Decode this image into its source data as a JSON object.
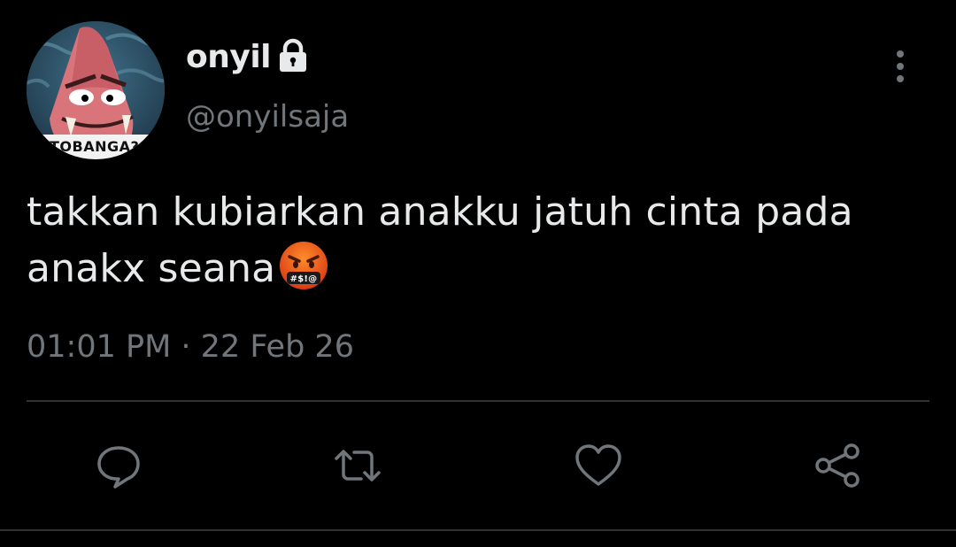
{
  "author": {
    "display_name": "onyil",
    "handle": "@onyilsaja",
    "verified_lock": "lock-icon",
    "avatar_caption": "TOBANGA?"
  },
  "tweet": {
    "text_main": "takkan kubiarkan anakku jatuh cinta pada anakx seana",
    "emoji": "face-with-symbols-on-mouth",
    "timestamp": "01:01 PM · 22 Feb 26"
  },
  "actions": [
    {
      "name": "reply",
      "icon": "speech-bubble-icon"
    },
    {
      "name": "retweet",
      "icon": "retweet-icon"
    },
    {
      "name": "like",
      "icon": "heart-icon"
    },
    {
      "name": "share",
      "icon": "share-icon"
    }
  ],
  "colors": {
    "background": "#000000",
    "primary_text": "#e7e9ea",
    "secondary_text": "#71767b",
    "divider": "#2f3336",
    "icon": "#71767b"
  }
}
